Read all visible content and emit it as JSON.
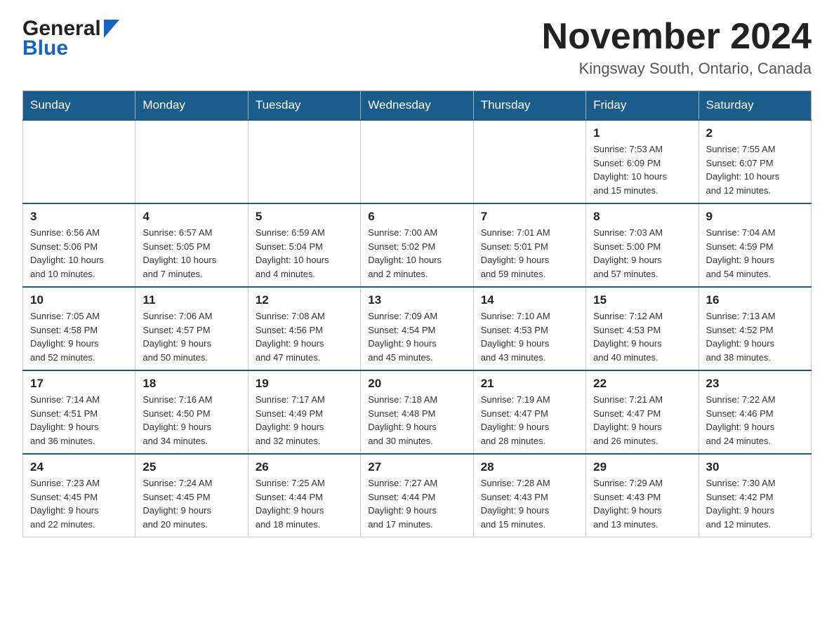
{
  "header": {
    "logo_general": "General",
    "logo_blue": "Blue",
    "month_title": "November 2024",
    "location": "Kingsway South, Ontario, Canada"
  },
  "weekdays": [
    "Sunday",
    "Monday",
    "Tuesday",
    "Wednesday",
    "Thursday",
    "Friday",
    "Saturday"
  ],
  "weeks": [
    [
      {
        "day": "",
        "info": ""
      },
      {
        "day": "",
        "info": ""
      },
      {
        "day": "",
        "info": ""
      },
      {
        "day": "",
        "info": ""
      },
      {
        "day": "",
        "info": ""
      },
      {
        "day": "1",
        "info": "Sunrise: 7:53 AM\nSunset: 6:09 PM\nDaylight: 10 hours\nand 15 minutes."
      },
      {
        "day": "2",
        "info": "Sunrise: 7:55 AM\nSunset: 6:07 PM\nDaylight: 10 hours\nand 12 minutes."
      }
    ],
    [
      {
        "day": "3",
        "info": "Sunrise: 6:56 AM\nSunset: 5:06 PM\nDaylight: 10 hours\nand 10 minutes."
      },
      {
        "day": "4",
        "info": "Sunrise: 6:57 AM\nSunset: 5:05 PM\nDaylight: 10 hours\nand 7 minutes."
      },
      {
        "day": "5",
        "info": "Sunrise: 6:59 AM\nSunset: 5:04 PM\nDaylight: 10 hours\nand 4 minutes."
      },
      {
        "day": "6",
        "info": "Sunrise: 7:00 AM\nSunset: 5:02 PM\nDaylight: 10 hours\nand 2 minutes."
      },
      {
        "day": "7",
        "info": "Sunrise: 7:01 AM\nSunset: 5:01 PM\nDaylight: 9 hours\nand 59 minutes."
      },
      {
        "day": "8",
        "info": "Sunrise: 7:03 AM\nSunset: 5:00 PM\nDaylight: 9 hours\nand 57 minutes."
      },
      {
        "day": "9",
        "info": "Sunrise: 7:04 AM\nSunset: 4:59 PM\nDaylight: 9 hours\nand 54 minutes."
      }
    ],
    [
      {
        "day": "10",
        "info": "Sunrise: 7:05 AM\nSunset: 4:58 PM\nDaylight: 9 hours\nand 52 minutes."
      },
      {
        "day": "11",
        "info": "Sunrise: 7:06 AM\nSunset: 4:57 PM\nDaylight: 9 hours\nand 50 minutes."
      },
      {
        "day": "12",
        "info": "Sunrise: 7:08 AM\nSunset: 4:56 PM\nDaylight: 9 hours\nand 47 minutes."
      },
      {
        "day": "13",
        "info": "Sunrise: 7:09 AM\nSunset: 4:54 PM\nDaylight: 9 hours\nand 45 minutes."
      },
      {
        "day": "14",
        "info": "Sunrise: 7:10 AM\nSunset: 4:53 PM\nDaylight: 9 hours\nand 43 minutes."
      },
      {
        "day": "15",
        "info": "Sunrise: 7:12 AM\nSunset: 4:53 PM\nDaylight: 9 hours\nand 40 minutes."
      },
      {
        "day": "16",
        "info": "Sunrise: 7:13 AM\nSunset: 4:52 PM\nDaylight: 9 hours\nand 38 minutes."
      }
    ],
    [
      {
        "day": "17",
        "info": "Sunrise: 7:14 AM\nSunset: 4:51 PM\nDaylight: 9 hours\nand 36 minutes."
      },
      {
        "day": "18",
        "info": "Sunrise: 7:16 AM\nSunset: 4:50 PM\nDaylight: 9 hours\nand 34 minutes."
      },
      {
        "day": "19",
        "info": "Sunrise: 7:17 AM\nSunset: 4:49 PM\nDaylight: 9 hours\nand 32 minutes."
      },
      {
        "day": "20",
        "info": "Sunrise: 7:18 AM\nSunset: 4:48 PM\nDaylight: 9 hours\nand 30 minutes."
      },
      {
        "day": "21",
        "info": "Sunrise: 7:19 AM\nSunset: 4:47 PM\nDaylight: 9 hours\nand 28 minutes."
      },
      {
        "day": "22",
        "info": "Sunrise: 7:21 AM\nSunset: 4:47 PM\nDaylight: 9 hours\nand 26 minutes."
      },
      {
        "day": "23",
        "info": "Sunrise: 7:22 AM\nSunset: 4:46 PM\nDaylight: 9 hours\nand 24 minutes."
      }
    ],
    [
      {
        "day": "24",
        "info": "Sunrise: 7:23 AM\nSunset: 4:45 PM\nDaylight: 9 hours\nand 22 minutes."
      },
      {
        "day": "25",
        "info": "Sunrise: 7:24 AM\nSunset: 4:45 PM\nDaylight: 9 hours\nand 20 minutes."
      },
      {
        "day": "26",
        "info": "Sunrise: 7:25 AM\nSunset: 4:44 PM\nDaylight: 9 hours\nand 18 minutes."
      },
      {
        "day": "27",
        "info": "Sunrise: 7:27 AM\nSunset: 4:44 PM\nDaylight: 9 hours\nand 17 minutes."
      },
      {
        "day": "28",
        "info": "Sunrise: 7:28 AM\nSunset: 4:43 PM\nDaylight: 9 hours\nand 15 minutes."
      },
      {
        "day": "29",
        "info": "Sunrise: 7:29 AM\nSunset: 4:43 PM\nDaylight: 9 hours\nand 13 minutes."
      },
      {
        "day": "30",
        "info": "Sunrise: 7:30 AM\nSunset: 4:42 PM\nDaylight: 9 hours\nand 12 minutes."
      }
    ]
  ]
}
